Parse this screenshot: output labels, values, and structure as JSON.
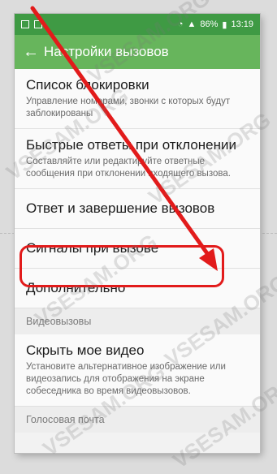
{
  "status_bar": {
    "battery": "86%",
    "time": "13:19"
  },
  "header": {
    "title": "Настройки вызовов",
    "back_label": "←"
  },
  "items": [
    {
      "title": "Список блокировки",
      "subtitle": "Управление номерами, звонки с которых будут заблокированы"
    },
    {
      "title": "Быстрые ответы при отклонении",
      "subtitle": "Составляйте или редактируйте ответные сообщения при отклонении входящего вызова."
    },
    {
      "title": "Ответ и завершение вызовов"
    },
    {
      "title": "Сигналы при вызове"
    },
    {
      "title": "Дополнительно"
    }
  ],
  "section_video": "Видеовызовы",
  "video_item": {
    "title": "Скрыть мое видео",
    "subtitle": "Установите альтернативное изображение или видеозапись для отображения на экране собеседника во время видеовызовов."
  },
  "section_voicemail": "Голосовая почта",
  "watermark": "VSESAM.ORG",
  "colors": {
    "status_bar": "#3f9a44",
    "app_bar": "#67b55c",
    "highlight": "#e21b1b",
    "arrow": "#e21b1b"
  }
}
